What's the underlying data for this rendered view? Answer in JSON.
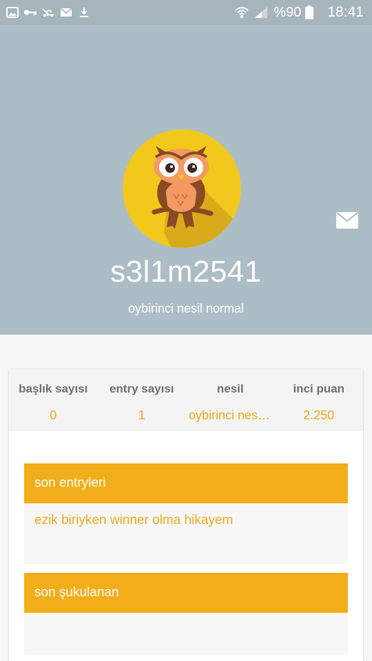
{
  "status_bar": {
    "battery_percent": "%90",
    "time": "18:41",
    "left_icons": [
      "gallery-icon",
      "key-icon",
      "vpn-icon",
      "mail-icon",
      "download-icon"
    ],
    "right_icons": [
      "wifi-icon",
      "signal-icon",
      "battery-icon"
    ]
  },
  "profile": {
    "username": "s3l1m2541",
    "generation": "oybirinci nesil normal",
    "avatar": "owl-avatar",
    "header_color": "#adbdc5",
    "accent_color": "#f2ad1a"
  },
  "stats": [
    {
      "label": "başlık sayısı",
      "value": "0"
    },
    {
      "label": "entry sayısı",
      "value": "1"
    },
    {
      "label": "nesil",
      "value": "oybirinci nesil normal"
    },
    {
      "label": "inci puan",
      "value": "2.250"
    }
  ],
  "sections": {
    "recent_entries": {
      "title": "son entryleri",
      "items": [
        "ezik biriyken winner olma hikayem"
      ]
    },
    "recent_liked": {
      "title": "son şukulanan",
      "items": []
    }
  }
}
